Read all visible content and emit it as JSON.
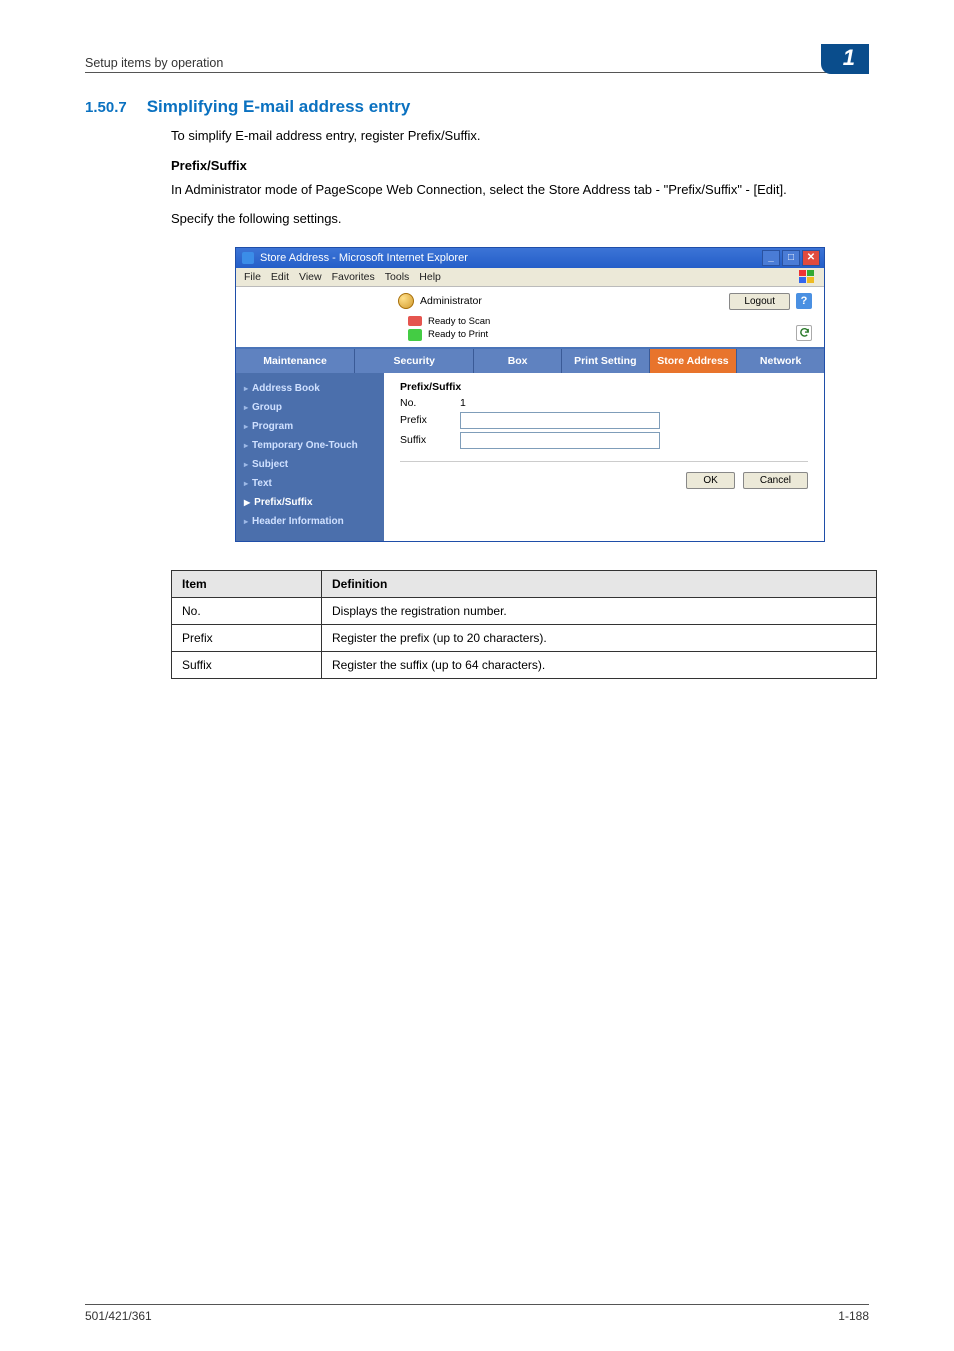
{
  "header": {
    "breadcrumb": "Setup items by operation",
    "chapter_number": "1"
  },
  "section": {
    "number": "1.50.7",
    "title": "Simplifying E-mail address entry",
    "intro": "To simplify E-mail address entry, register Prefix/Suffix.",
    "sub_heading": "Prefix/Suffix",
    "para1": "In Administrator mode of PageScope Web Connection, select the Store Address tab - \"Prefix/Suffix\" - [Edit].",
    "para2": "Specify the following settings."
  },
  "window": {
    "title": "Store Address - Microsoft Internet Explorer",
    "menus": [
      "File",
      "Edit",
      "View",
      "Favorites",
      "Tools",
      "Help"
    ],
    "admin_label": "Administrator",
    "logout_label": "Logout",
    "help_label": "?",
    "status1": "Ready to Scan",
    "status2": "Ready to Print",
    "tabs": [
      "Maintenance",
      "Security",
      "Box",
      "Print Setting",
      "Store Address",
      "Network"
    ],
    "active_tab_index": 4,
    "sidebar": [
      "Address Book",
      "Group",
      "Program",
      "Temporary One-Touch",
      "Subject",
      "Text",
      "Prefix/Suffix",
      "Header Information"
    ],
    "sidebar_selected_index": 6,
    "form": {
      "heading": "Prefix/Suffix",
      "row_no_label": "No.",
      "row_no_value": "1",
      "row_prefix_label": "Prefix",
      "row_prefix_value": "",
      "row_suffix_label": "Suffix",
      "row_suffix_value": "",
      "ok_label": "OK",
      "cancel_label": "Cancel"
    }
  },
  "def_table": {
    "head_item": "Item",
    "head_def": "Definition",
    "rows": [
      {
        "item": "No.",
        "def": "Displays the registration number."
      },
      {
        "item": "Prefix",
        "def": "Register the prefix (up to 20 characters)."
      },
      {
        "item": "Suffix",
        "def": "Register the suffix (up to 64 characters)."
      }
    ]
  },
  "footer": {
    "left": "501/421/361",
    "right": "1-188"
  }
}
